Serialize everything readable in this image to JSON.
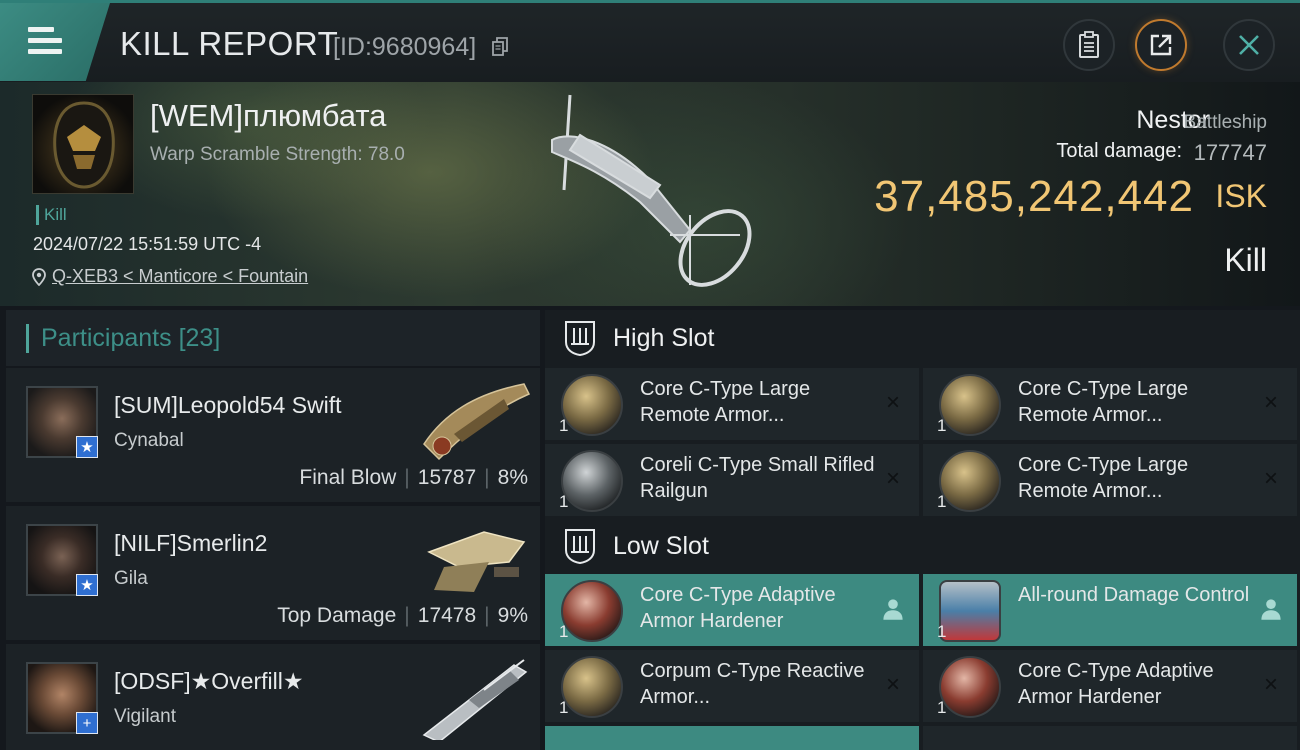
{
  "header": {
    "title": "KILL REPORT",
    "report_id": "[ID:9680964]"
  },
  "victim": {
    "name": "[WEM]плюмбата",
    "warp_scramble": "Warp Scramble Strength: 78.0",
    "kill_tag": "Kill",
    "datetime": "2024/07/22 15:51:59 UTC -4",
    "location": "Q-XEB3 < Manticore < Fountain",
    "ship_name": "Nestor",
    "ship_class": "Battleship",
    "total_damage_label": "Total damage:",
    "total_damage": "177747",
    "isk_value": "37,485,242,442",
    "isk_unit": "ISK",
    "result": "Kill"
  },
  "participants": {
    "title": "Participants",
    "count": "[23]",
    "rows": [
      {
        "name": "[SUM]Leopold54 Swift",
        "ship": "Cynabal",
        "role": "Final Blow",
        "damage": "15787",
        "percent": "8%",
        "badge": "★"
      },
      {
        "name": "[NILF]Smerlin2",
        "ship": "Gila",
        "role": "Top Damage",
        "damage": "17478",
        "percent": "9%",
        "badge": "★"
      },
      {
        "name": "[ODSF]★Overfill★",
        "ship": "Vigilant",
        "role": "",
        "damage": "",
        "percent": "",
        "badge": "+"
      }
    ]
  },
  "slots": {
    "high_title": "High Slot",
    "low_title": "Low Slot",
    "high": [
      {
        "qty": "1",
        "name": "Core C-Type Large Remote Armor...",
        "action": "×"
      },
      {
        "qty": "1",
        "name": "Core C-Type Large Remote Armor...",
        "action": "×"
      },
      {
        "qty": "1",
        "name": "Coreli C-Type Small Rifled Railgun",
        "action": "×"
      },
      {
        "qty": "1",
        "name": "Core C-Type Large Remote Armor...",
        "action": "×"
      }
    ],
    "low": [
      {
        "qty": "1",
        "name": "Core C-Type Adaptive Armor Hardener",
        "action": "person"
      },
      {
        "qty": "1",
        "name": "All-round Damage Control",
        "action": "person"
      },
      {
        "qty": "1",
        "name": "Corpum C-Type Reactive Armor...",
        "action": "×"
      },
      {
        "qty": "1",
        "name": "Core C-Type Adaptive Armor Hardener",
        "action": "×"
      }
    ]
  }
}
